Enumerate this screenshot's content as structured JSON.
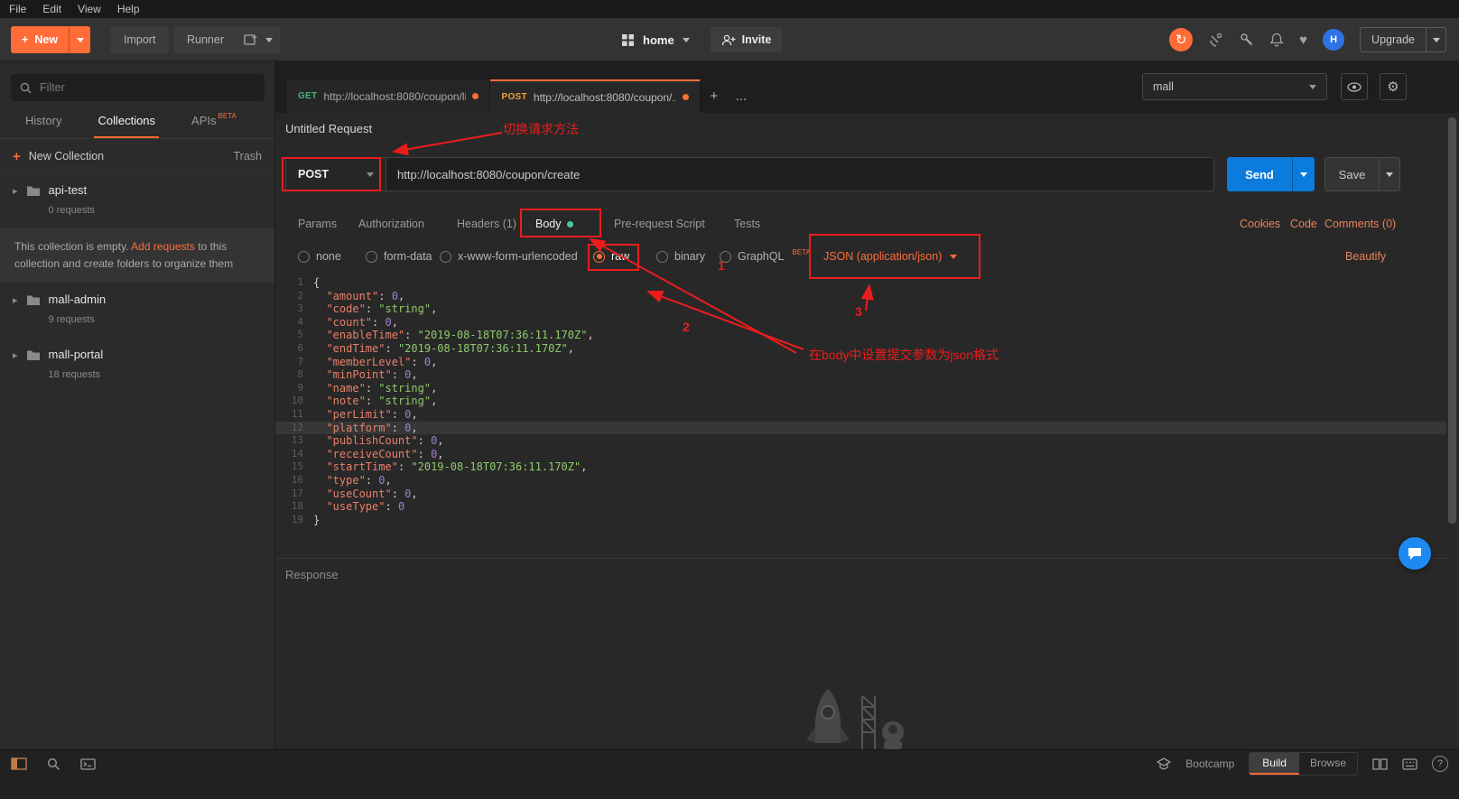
{
  "menu": {
    "file": "File",
    "edit": "Edit",
    "view": "View",
    "help": "Help"
  },
  "toolbar": {
    "new": "New",
    "import": "Import",
    "runner": "Runner",
    "workspace": "home",
    "invite": "Invite",
    "upgrade": "Upgrade"
  },
  "icons": {
    "plus": "+",
    "ellipsis": "...",
    "sync": "↻",
    "heart": "♥",
    "gear": "⚙",
    "help": "?",
    "avatar_letter": "H",
    "caret_right": "▸"
  },
  "tabstrip": {
    "tabs": [
      {
        "method": "GET",
        "url": "http://localhost:8080/coupon/li..."
      },
      {
        "method": "POST",
        "url": "http://localhost:8080/coupon/..."
      }
    ],
    "environment": "mall"
  },
  "sidebar": {
    "filter_placeholder": "Filter",
    "tab_history": "History",
    "tab_collections": "Collections",
    "tab_apis": "APIs",
    "apis_badge": "BETA",
    "new_collection": "New Collection",
    "trash": "Trash",
    "collections": [
      {
        "name": "api-test",
        "meta": "0 requests"
      },
      {
        "name": "mall-admin",
        "meta": "9 requests"
      },
      {
        "name": "mall-portal",
        "meta": "18 requests"
      }
    ],
    "empty_pre": "This collection is empty.",
    "empty_link": "Add requests",
    "empty_post": "to this collection and create folders to organize them"
  },
  "request": {
    "title": "Untitled Request",
    "method": "POST",
    "url": "http://localhost:8080/coupon/create",
    "send": "Send",
    "save": "Save",
    "tab_params": "Params",
    "tab_auth": "Authorization",
    "tab_headers": "Headers (1)",
    "tab_body": "Body",
    "tab_prescript": "Pre-request Script",
    "tab_tests": "Tests",
    "link_cookies": "Cookies",
    "link_code": "Code",
    "link_comments": "Comments (0)",
    "mode_none": "none",
    "mode_formdata": "form-data",
    "mode_urlencoded": "x-www-form-urlencoded",
    "mode_raw": "raw",
    "mode_binary": "binary",
    "mode_graphql": "GraphQL",
    "graphql_badge": "BETA",
    "content_type": "JSON (application/json)",
    "beautify": "Beautify"
  },
  "editor": {
    "lines": [
      {
        "n": 1,
        "t": [
          [
            "p",
            "{"
          ]
        ]
      },
      {
        "n": 2,
        "t": [
          [
            "p",
            "  "
          ],
          [
            "k",
            "\"amount\""
          ],
          [
            "p",
            ": "
          ],
          [
            "d",
            "0"
          ],
          [
            "p",
            ","
          ]
        ]
      },
      {
        "n": 3,
        "t": [
          [
            "p",
            "  "
          ],
          [
            "k",
            "\"code\""
          ],
          [
            "p",
            ": "
          ],
          [
            "s",
            "\"string\""
          ],
          [
            "p",
            ","
          ]
        ]
      },
      {
        "n": 4,
        "t": [
          [
            "p",
            "  "
          ],
          [
            "k",
            "\"count\""
          ],
          [
            "p",
            ": "
          ],
          [
            "d",
            "0"
          ],
          [
            "p",
            ","
          ]
        ]
      },
      {
        "n": 5,
        "t": [
          [
            "p",
            "  "
          ],
          [
            "k",
            "\"enableTime\""
          ],
          [
            "p",
            ": "
          ],
          [
            "s",
            "\"2019-08-18T07:36:11.170Z\""
          ],
          [
            "p",
            ","
          ]
        ]
      },
      {
        "n": 6,
        "t": [
          [
            "p",
            "  "
          ],
          [
            "k",
            "\"endTime\""
          ],
          [
            "p",
            ": "
          ],
          [
            "s",
            "\"2019-08-18T07:36:11.170Z\""
          ],
          [
            "p",
            ","
          ]
        ]
      },
      {
        "n": 7,
        "t": [
          [
            "p",
            "  "
          ],
          [
            "k",
            "\"memberLevel\""
          ],
          [
            "p",
            ": "
          ],
          [
            "d",
            "0"
          ],
          [
            "p",
            ","
          ]
        ]
      },
      {
        "n": 8,
        "t": [
          [
            "p",
            "  "
          ],
          [
            "k",
            "\"minPoint\""
          ],
          [
            "p",
            ": "
          ],
          [
            "d",
            "0"
          ],
          [
            "p",
            ","
          ]
        ]
      },
      {
        "n": 9,
        "t": [
          [
            "p",
            "  "
          ],
          [
            "k",
            "\"name\""
          ],
          [
            "p",
            ": "
          ],
          [
            "s",
            "\"string\""
          ],
          [
            "p",
            ","
          ]
        ]
      },
      {
        "n": 10,
        "t": [
          [
            "p",
            "  "
          ],
          [
            "k",
            "\"note\""
          ],
          [
            "p",
            ": "
          ],
          [
            "s",
            "\"string\""
          ],
          [
            "p",
            ","
          ]
        ]
      },
      {
        "n": 11,
        "t": [
          [
            "p",
            "  "
          ],
          [
            "k",
            "\"perLimit\""
          ],
          [
            "p",
            ": "
          ],
          [
            "d",
            "0"
          ],
          [
            "p",
            ","
          ]
        ]
      },
      {
        "n": 12,
        "active": true,
        "t": [
          [
            "p",
            "  "
          ],
          [
            "k",
            "\"platform\""
          ],
          [
            "p",
            ": "
          ],
          [
            "d",
            "0"
          ],
          [
            "p",
            ","
          ]
        ]
      },
      {
        "n": 13,
        "t": [
          [
            "p",
            "  "
          ],
          [
            "k",
            "\"publishCount\""
          ],
          [
            "p",
            ": "
          ],
          [
            "d",
            "0"
          ],
          [
            "p",
            ","
          ]
        ]
      },
      {
        "n": 14,
        "t": [
          [
            "p",
            "  "
          ],
          [
            "k",
            "\"receiveCount\""
          ],
          [
            "p",
            ": "
          ],
          [
            "d",
            "0"
          ],
          [
            "p",
            ","
          ]
        ]
      },
      {
        "n": 15,
        "t": [
          [
            "p",
            "  "
          ],
          [
            "k",
            "\"startTime\""
          ],
          [
            "p",
            ": "
          ],
          [
            "s",
            "\"2019-08-18T07:36:11.170Z\""
          ],
          [
            "p",
            ","
          ]
        ]
      },
      {
        "n": 16,
        "t": [
          [
            "p",
            "  "
          ],
          [
            "k",
            "\"type\""
          ],
          [
            "p",
            ": "
          ],
          [
            "d",
            "0"
          ],
          [
            "p",
            ","
          ]
        ]
      },
      {
        "n": 17,
        "t": [
          [
            "p",
            "  "
          ],
          [
            "k",
            "\"useCount\""
          ],
          [
            "p",
            ": "
          ],
          [
            "d",
            "0"
          ],
          [
            "p",
            ","
          ]
        ]
      },
      {
        "n": 18,
        "t": [
          [
            "p",
            "  "
          ],
          [
            "k",
            "\"useType\""
          ],
          [
            "p",
            ": "
          ],
          [
            "d",
            "0"
          ]
        ]
      },
      {
        "n": 19,
        "t": [
          [
            "p",
            "}"
          ]
        ]
      }
    ]
  },
  "response": {
    "label": "Response"
  },
  "annotations": {
    "method_note": "切换请求方法",
    "body_note": "在body中设置提交参数为json格式",
    "step1": "1",
    "step2": "2",
    "step3": "3"
  },
  "footer": {
    "bootcamp": "Bootcamp",
    "build": "Build",
    "browse": "Browse"
  },
  "colors": {
    "accent": "#ff6c37",
    "send_blue": "#0b7bdc",
    "annotation_red": "#ed1c1c",
    "method_get": "#4caf7d",
    "method_post": "#e8a33d",
    "json_key": "#e8806a",
    "json_string": "#8fca6c",
    "json_number": "#a07fce"
  }
}
